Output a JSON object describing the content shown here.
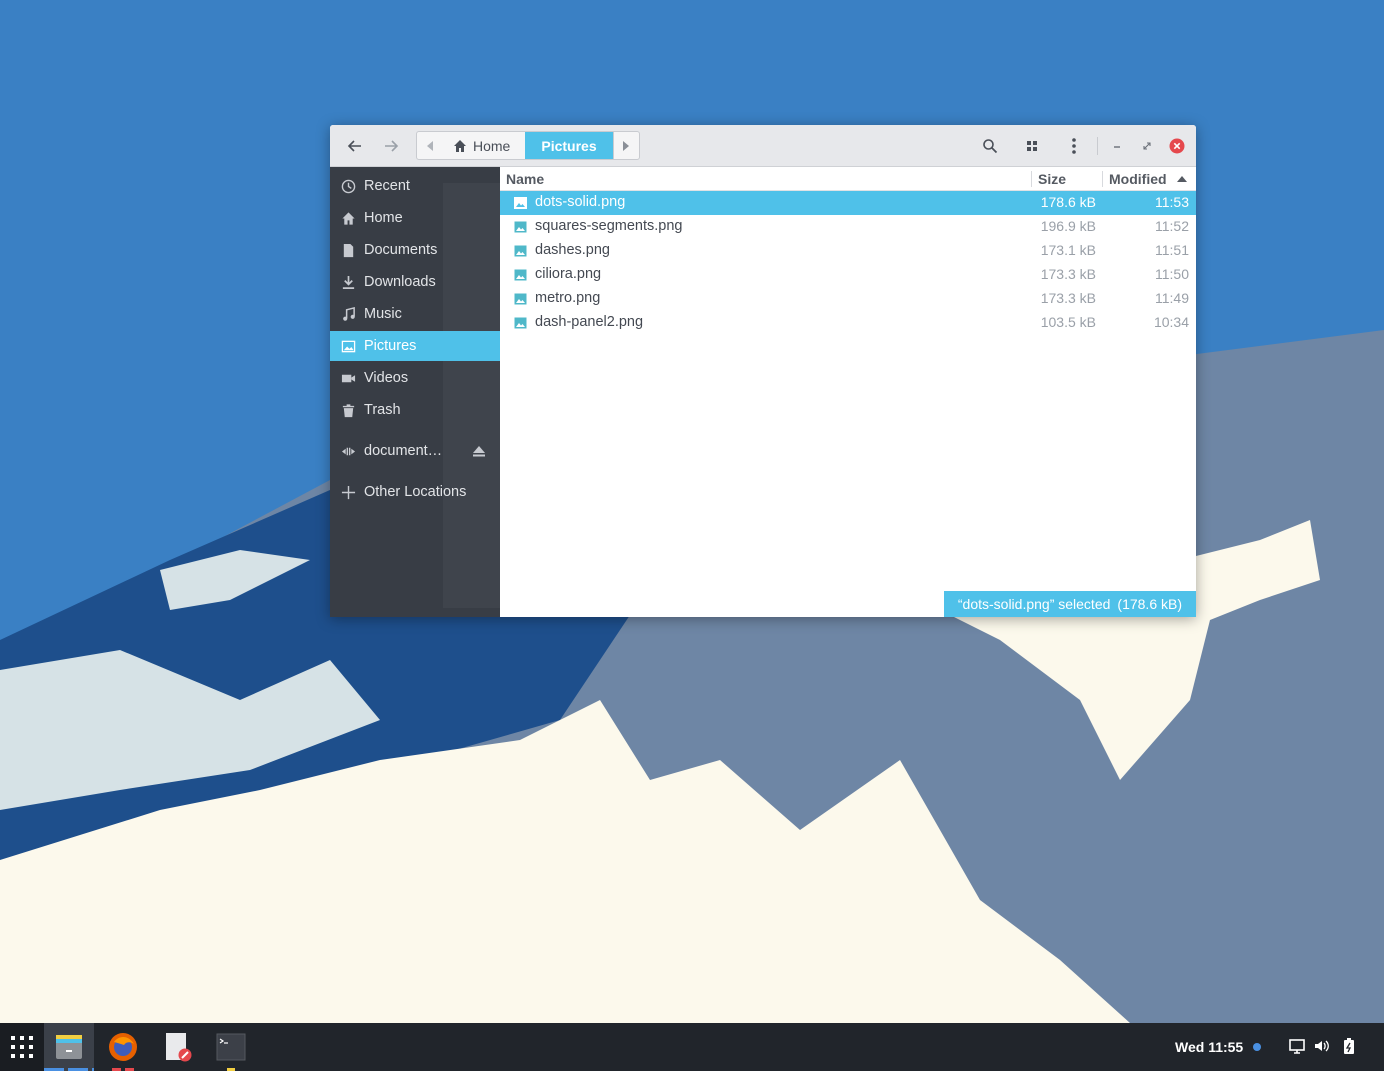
{
  "window": {
    "nav": {
      "back_icon": "arrow-left-icon",
      "forward_icon": "arrow-right-icon"
    },
    "pathbar": {
      "segments": [
        {
          "label": "Home",
          "icon": "home-icon"
        },
        {
          "label": "Pictures",
          "active": true
        }
      ]
    },
    "toolbar": {
      "search_icon": "search-icon",
      "view_icon": "grid-icon",
      "menu_icon": "kebab-menu-icon",
      "minimize_icon": "minimize-icon",
      "maximize_icon": "maximize-icon",
      "close_icon": "close-icon"
    }
  },
  "sidebar": {
    "items": [
      {
        "label": "Recent",
        "icon": "clock-icon"
      },
      {
        "label": "Home",
        "icon": "home-icon"
      },
      {
        "label": "Documents",
        "icon": "document-icon"
      },
      {
        "label": "Downloads",
        "icon": "download-icon"
      },
      {
        "label": "Music",
        "icon": "music-icon"
      },
      {
        "label": "Pictures",
        "icon": "picture-icon",
        "active": true
      },
      {
        "label": "Videos",
        "icon": "video-icon"
      },
      {
        "label": "Trash",
        "icon": "trash-icon"
      },
      {
        "label": "document…",
        "icon": "network-drive-icon",
        "eject": true
      },
      {
        "label": "Other Locations",
        "icon": "plus-icon"
      }
    ]
  },
  "file_list": {
    "columns": {
      "name": "Name",
      "size": "Size",
      "modified": "Modified"
    },
    "sort": {
      "column": "Modified",
      "direction": "ascending"
    },
    "rows": [
      {
        "name": "dots-solid.png",
        "size": "178.6 kB",
        "modified": "11:53",
        "selected": true
      },
      {
        "name": "squares-segments.png",
        "size": "196.9 kB",
        "modified": "11:52"
      },
      {
        "name": "dashes.png",
        "size": "173.1 kB",
        "modified": "11:51"
      },
      {
        "name": "ciliora.png",
        "size": "173.3 kB",
        "modified": "11:50"
      },
      {
        "name": "metro.png",
        "size": "173.3 kB",
        "modified": "11:49"
      },
      {
        "name": "dash-panel2.png",
        "size": "103.5 kB",
        "modified": "10:34"
      }
    ]
  },
  "status": {
    "text": "“dots-solid.png” selected",
    "size": "(178.6 kB)"
  },
  "panel": {
    "clock": "Wed 11:55",
    "apps": [
      {
        "name": "files",
        "icon": "file-manager-icon",
        "active": true
      },
      {
        "name": "firefox",
        "icon": "firefox-icon"
      },
      {
        "name": "text-editor",
        "icon": "text-editor-icon"
      },
      {
        "name": "terminal",
        "icon": "terminal-icon"
      }
    ],
    "tray": [
      "display-icon",
      "volume-icon",
      "battery-icon"
    ]
  },
  "colors": {
    "accent": "#4fc1e9",
    "sidebar_bg": "#383d45",
    "panel_bg": "#21252b",
    "sky": "#3a80c4"
  }
}
